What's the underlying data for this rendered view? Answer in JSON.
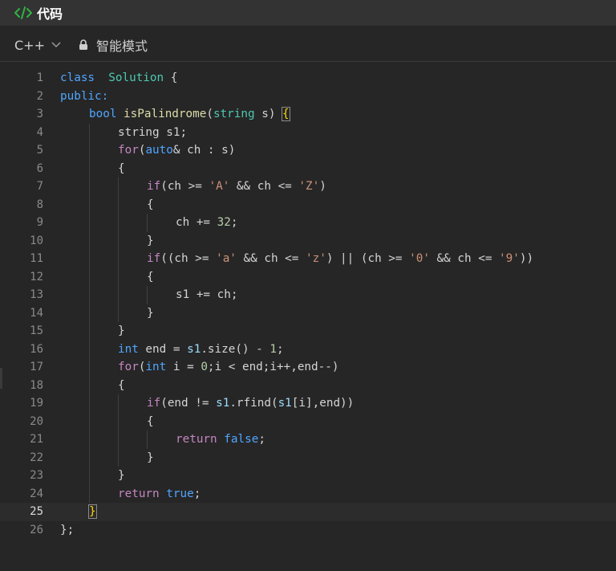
{
  "header": {
    "title": "代码",
    "icon": "code-icon",
    "icon_color": "#2fb344"
  },
  "toolbar": {
    "language": "C++",
    "mode_label": "智能模式"
  },
  "editor": {
    "active_line": 25,
    "colors": {
      "keyword": "#c586c0",
      "builtin": "#4fa6ff",
      "type": "#4ec9b0",
      "string": "#ce9178",
      "number": "#b5cea8"
    },
    "lines": [
      {
        "n": "1",
        "indent": 0,
        "tokens": [
          [
            "kb",
            "class"
          ],
          [
            "",
            "  "
          ],
          [
            "ty",
            "Solution"
          ],
          [
            "",
            " {"
          ]
        ]
      },
      {
        "n": "2",
        "indent": 0,
        "tokens": [
          [
            "kb",
            "public:"
          ]
        ]
      },
      {
        "n": "3",
        "indent": 1,
        "tokens": [
          [
            "kb",
            "bool"
          ],
          [
            "",
            " "
          ],
          [
            "fn",
            "isPalindrome"
          ],
          [
            "",
            "("
          ],
          [
            "ty",
            "string"
          ],
          [
            "",
            " s) "
          ],
          [
            "brk",
            "{"
          ]
        ]
      },
      {
        "n": "4",
        "indent": 2,
        "tokens": [
          [
            "",
            "string s1;"
          ]
        ]
      },
      {
        "n": "5",
        "indent": 2,
        "tokens": [
          [
            "kw",
            "for"
          ],
          [
            "",
            "("
          ],
          [
            "kb",
            "auto"
          ],
          [
            "",
            "& ch : s)"
          ]
        ]
      },
      {
        "n": "6",
        "indent": 2,
        "tokens": [
          [
            "",
            "{"
          ]
        ]
      },
      {
        "n": "7",
        "indent": 3,
        "tokens": [
          [
            "kw",
            "if"
          ],
          [
            "",
            "(ch >= "
          ],
          [
            "str",
            "'A'"
          ],
          [
            "",
            " && ch <= "
          ],
          [
            "str",
            "'Z'"
          ],
          [
            "",
            ")"
          ]
        ]
      },
      {
        "n": "8",
        "indent": 3,
        "tokens": [
          [
            "",
            "{"
          ]
        ]
      },
      {
        "n": "9",
        "indent": 4,
        "tokens": [
          [
            "",
            "ch += "
          ],
          [
            "num",
            "32"
          ],
          [
            "",
            ";"
          ]
        ]
      },
      {
        "n": "10",
        "indent": 3,
        "tokens": [
          [
            "",
            "}"
          ]
        ]
      },
      {
        "n": "11",
        "indent": 3,
        "tokens": [
          [
            "kw",
            "if"
          ],
          [
            "",
            "((ch >= "
          ],
          [
            "str",
            "'a'"
          ],
          [
            "",
            " && ch <= "
          ],
          [
            "str",
            "'z'"
          ],
          [
            "",
            ") || (ch >= "
          ],
          [
            "str",
            "'0'"
          ],
          [
            "",
            " && ch <= "
          ],
          [
            "str",
            "'9'"
          ],
          [
            "",
            "))"
          ]
        ]
      },
      {
        "n": "12",
        "indent": 3,
        "tokens": [
          [
            "",
            "{"
          ]
        ]
      },
      {
        "n": "13",
        "indent": 4,
        "tokens": [
          [
            "",
            "s1 += ch;"
          ]
        ]
      },
      {
        "n": "14",
        "indent": 3,
        "tokens": [
          [
            "",
            "}"
          ]
        ]
      },
      {
        "n": "15",
        "indent": 2,
        "tokens": [
          [
            "",
            "}"
          ]
        ]
      },
      {
        "n": "16",
        "indent": 2,
        "tokens": [
          [
            "kb",
            "int"
          ],
          [
            "",
            " end = "
          ],
          [
            "var",
            "s1"
          ],
          [
            "",
            ".size() - "
          ],
          [
            "num",
            "1"
          ],
          [
            "",
            ";"
          ]
        ]
      },
      {
        "n": "17",
        "indent": 2,
        "tokens": [
          [
            "kw",
            "for"
          ],
          [
            "",
            "("
          ],
          [
            "kb",
            "int"
          ],
          [
            "",
            " i = "
          ],
          [
            "num",
            "0"
          ],
          [
            "",
            ";i < end;i++,end--)"
          ]
        ]
      },
      {
        "n": "18",
        "indent": 2,
        "tokens": [
          [
            "",
            "{"
          ]
        ]
      },
      {
        "n": "19",
        "indent": 3,
        "tokens": [
          [
            "kw",
            "if"
          ],
          [
            "",
            "(end != "
          ],
          [
            "var",
            "s1"
          ],
          [
            "",
            ".rfind("
          ],
          [
            "var",
            "s1"
          ],
          [
            "",
            "[i],end))"
          ]
        ]
      },
      {
        "n": "20",
        "indent": 3,
        "tokens": [
          [
            "",
            "{"
          ]
        ]
      },
      {
        "n": "21",
        "indent": 4,
        "tokens": [
          [
            "kw",
            "return"
          ],
          [
            "",
            " "
          ],
          [
            "kb",
            "false"
          ],
          [
            "",
            ";"
          ]
        ]
      },
      {
        "n": "22",
        "indent": 3,
        "tokens": [
          [
            "",
            "}"
          ]
        ]
      },
      {
        "n": "23",
        "indent": 2,
        "tokens": [
          [
            "",
            "}"
          ]
        ]
      },
      {
        "n": "24",
        "indent": 2,
        "tokens": [
          [
            "kw",
            "return"
          ],
          [
            "",
            " "
          ],
          [
            "kb",
            "true"
          ],
          [
            "",
            ";"
          ]
        ]
      },
      {
        "n": "25",
        "indent": 1,
        "tokens": [
          [
            "brk",
            "}"
          ]
        ]
      },
      {
        "n": "26",
        "indent": 0,
        "tokens": [
          [
            "",
            "};"
          ]
        ]
      }
    ]
  }
}
